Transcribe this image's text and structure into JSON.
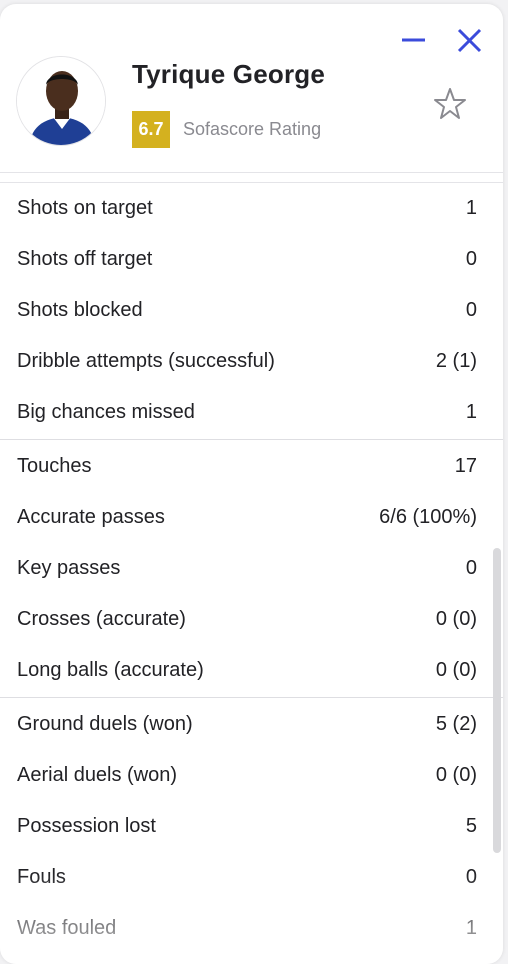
{
  "player": {
    "name": "Tyrique George",
    "rating": "6.7",
    "rating_label": "Sofascore Rating"
  },
  "icons": {
    "minimize": "minimize-icon",
    "close": "close-icon",
    "favorite": "star-outline-icon"
  },
  "colors": {
    "accent_blue": "#3b4bdb",
    "rating_badge": "#d4b11f",
    "text": "#222226",
    "muted": "#8a8a90"
  },
  "stats": {
    "group1": [
      {
        "label": "Shots on target",
        "value": "1"
      },
      {
        "label": "Shots off target",
        "value": "0"
      },
      {
        "label": "Shots blocked",
        "value": "0"
      },
      {
        "label": "Dribble attempts (successful)",
        "value": "2 (1)"
      },
      {
        "label": "Big chances missed",
        "value": "1"
      }
    ],
    "group2": [
      {
        "label": "Touches",
        "value": "17"
      },
      {
        "label": "Accurate passes",
        "value": "6/6 (100%)"
      },
      {
        "label": "Key passes",
        "value": "0"
      },
      {
        "label": "Crosses (accurate)",
        "value": "0 (0)"
      },
      {
        "label": "Long balls (accurate)",
        "value": "0 (0)"
      }
    ],
    "group3": [
      {
        "label": "Ground duels (won)",
        "value": "5 (2)"
      },
      {
        "label": "Aerial duels (won)",
        "value": "0 (0)"
      },
      {
        "label": "Possession lost",
        "value": "5"
      },
      {
        "label": "Fouls",
        "value": "0"
      },
      {
        "label": "Was fouled",
        "value": "1"
      }
    ]
  }
}
